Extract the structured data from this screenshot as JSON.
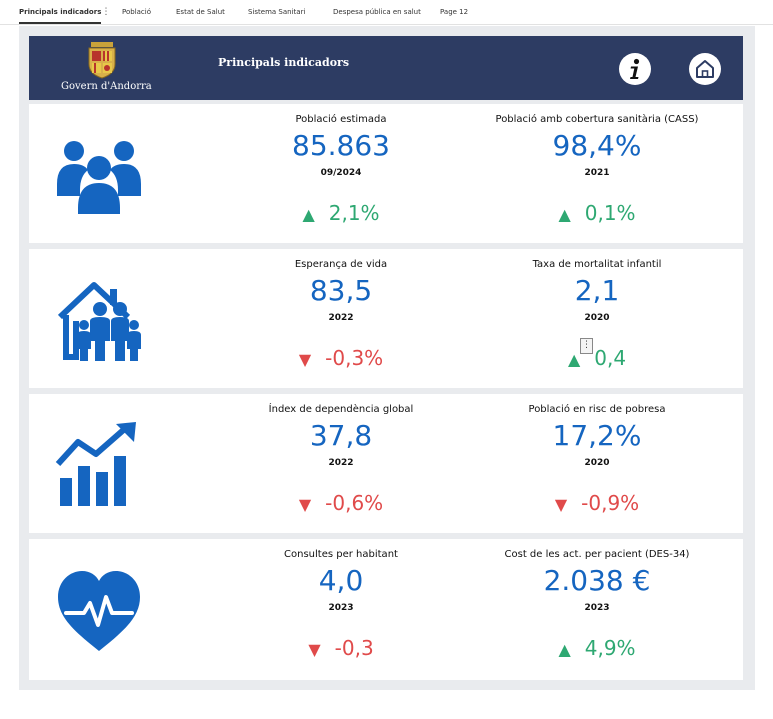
{
  "tabs": [
    {
      "label": "Principals indicadors",
      "active": true
    },
    {
      "label": "Població"
    },
    {
      "label": "Estat de Salut"
    },
    {
      "label": "Sistema Sanitari"
    },
    {
      "label": "Despesa pública en salut"
    },
    {
      "label": "Page 12"
    }
  ],
  "header": {
    "logo_text": "Govern d'Andorra",
    "title": "Principals indicadors",
    "info_icon": "info-icon",
    "home_icon": "home-icon",
    "color": "#2d3c63"
  },
  "colors": {
    "value": "#1565c0",
    "up": "#2ea872",
    "down": "#e04a4a"
  },
  "cards": [
    {
      "icon": "people-icon",
      "left": {
        "label": "Població estimada",
        "value": "85.863",
        "period": "09/2024",
        "change": "2,1%",
        "direction": "up",
        "arrow": "▲"
      },
      "right": {
        "label": "Població amb cobertura sanitària (CASS)",
        "value": "98,4%",
        "period": "2021",
        "change": "0,1%",
        "direction": "up",
        "arrow": "▲"
      }
    },
    {
      "icon": "family-house-icon",
      "left": {
        "label": "Esperança de vida",
        "value": "83,5",
        "period": "2022",
        "change": "-0,3%",
        "direction": "down",
        "arrow": "▼"
      },
      "right": {
        "label": "Taxa de mortalitat infantil",
        "value": "2,1",
        "period": "2020",
        "change": "0,4",
        "direction": "up",
        "arrow": "▲"
      }
    },
    {
      "icon": "growth-chart-icon",
      "left": {
        "label": "Índex de dependència global",
        "value": "37,8",
        "period": "2022",
        "change": "-0,6%",
        "direction": "down",
        "arrow": "▼"
      },
      "right": {
        "label": "Població en risc de pobresa",
        "value": "17,2%",
        "period": "2020",
        "change": "-0,9%",
        "direction": "down",
        "arrow": "▼"
      }
    },
    {
      "icon": "heart-pulse-icon",
      "left": {
        "label": "Consultes per habitant",
        "value": "4,0",
        "period": "2023",
        "change": "-0,3",
        "direction": "down",
        "arrow": "▼"
      },
      "right": {
        "label": "Cost de les act. per pacient (DES-34)",
        "value": "2.038 €",
        "period": "2023",
        "change": "4,9%",
        "direction": "up",
        "arrow": "▲"
      }
    }
  ]
}
